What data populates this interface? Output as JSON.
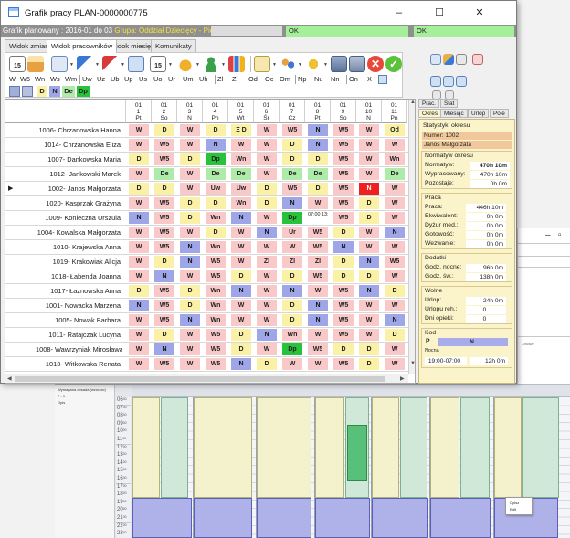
{
  "window": {
    "title": "Grafik pracy PLAN-0000000775",
    "minimize": "–",
    "maximize": "☐",
    "close": "✕"
  },
  "infobar": {
    "text": "Grafik planowany : 2016-01 do 03",
    "group": "Grupa: Oddział Dziecięcy - Pielęgniarki",
    "ok1": "OK",
    "ok2": "OK"
  },
  "tabs": [
    "Widok zmian",
    "Widok pracowników",
    "Widok miesięcy",
    "Komunikaty"
  ],
  "toolbar": {
    "codes": [
      "W",
      "W5",
      "Wn",
      "Ws",
      "Wm",
      "Uw",
      "Uz",
      "Ub",
      "Up",
      "Us",
      "Uo",
      "Ur",
      "Um",
      "Uh",
      "Zl",
      "Zi",
      "Od",
      "Oc",
      "Om",
      "Np",
      "Nu",
      "Nn",
      "On",
      "X"
    ],
    "shifts": [
      "D",
      "N",
      "De",
      "Dp"
    ],
    "calendar_day": "15"
  },
  "grid": {
    "days": [
      {
        "d": "1",
        "dow": "Pt"
      },
      {
        "d": "2",
        "dow": "So"
      },
      {
        "d": "3",
        "dow": "N"
      },
      {
        "d": "4",
        "dow": "Pn"
      },
      {
        "d": "5",
        "dow": "Wt"
      },
      {
        "d": "6",
        "dow": "Śr"
      },
      {
        "d": "7",
        "dow": "Cz"
      },
      {
        "d": "8",
        "dow": "Pt"
      },
      {
        "d": "9",
        "dow": "So"
      },
      {
        "d": "10",
        "dow": "N"
      },
      {
        "d": "11",
        "dow": "Pn"
      }
    ],
    "month": "01",
    "rows": [
      {
        "name": "1006- Chrzanowska Hanna",
        "cells": [
          "W",
          "D",
          "W",
          "D",
          "Ξ D",
          "W",
          "W5",
          "N",
          "W5",
          "W",
          "Od"
        ]
      },
      {
        "name": "1014- Chrzanowska Eliza",
        "cells": [
          "W",
          "W5",
          "W",
          "N",
          "W",
          "W",
          "D",
          "N",
          "W5",
          "W",
          "W"
        ]
      },
      {
        "name": "1007- Dankowska Maria",
        "cells": [
          "D",
          "W5",
          "D",
          "Dp",
          "Wn",
          "W",
          "D",
          "D",
          "W5",
          "W",
          "Wn"
        ]
      },
      {
        "name": "1012- Jankowski Marek",
        "cells": [
          "W",
          "De",
          "W",
          "De",
          "De",
          "W",
          "De",
          "De",
          "W5",
          "W",
          "De"
        ]
      },
      {
        "name": "1002- Janos Małgorzata",
        "cells": [
          "D",
          "D",
          "W",
          "Uw",
          "Uw",
          "D",
          "W5",
          "D",
          "W5",
          "N",
          "W"
        ]
      },
      {
        "name": "1020- Kasprzak Grażyna",
        "cells": [
          "W",
          "W5",
          "D",
          "D",
          "Wn",
          "D",
          "N",
          "W",
          "W5",
          "D",
          "W"
        ]
      },
      {
        "name": "1009- Konieczna Urszula",
        "cells": [
          "N",
          "W5",
          "D",
          "Wn",
          "N",
          "W",
          "Dp",
          "07:00 13:35",
          "W5",
          "D",
          "W"
        ]
      },
      {
        "name": "1004- Kowalska Małgorzata",
        "cells": [
          "W",
          "W5",
          "W",
          "D",
          "W",
          "N",
          "Ur",
          "W5",
          "D",
          "W",
          "N"
        ]
      },
      {
        "name": "1010- Krajewska Anna",
        "cells": [
          "W",
          "W5",
          "N",
          "Wn",
          "W",
          "W",
          "W",
          "W5",
          "N",
          "W",
          "W"
        ]
      },
      {
        "name": "1019- Krakowiak Alicja",
        "cells": [
          "W",
          "D",
          "N",
          "W5",
          "W",
          "Zl",
          "Zl",
          "Zl",
          "D",
          "N",
          "W5"
        ]
      },
      {
        "name": "1018- Łabenda Joanna",
        "cells": [
          "W",
          "N",
          "W",
          "W5",
          "D",
          "W",
          "D",
          "W5",
          "D",
          "D",
          "W"
        ]
      },
      {
        "name": "1017- Łaznowska Anna",
        "cells": [
          "D",
          "W5",
          "D",
          "Wn",
          "N",
          "W",
          "N",
          "W",
          "W5",
          "N",
          "D"
        ]
      },
      {
        "name": "1001- Nowacka Marzena",
        "cells": [
          "N",
          "W5",
          "D",
          "Wn",
          "W",
          "W",
          "D",
          "N",
          "W5",
          "W",
          "W"
        ]
      },
      {
        "name": "1005- Nowak Barbara",
        "cells": [
          "W",
          "W5",
          "N",
          "Wn",
          "W",
          "W",
          "D",
          "N",
          "W5",
          "W",
          "N"
        ]
      },
      {
        "name": "1011- Ratajczak Lucyna",
        "cells": [
          "W",
          "D",
          "W",
          "W5",
          "D",
          "N",
          "Wn",
          "W",
          "W5",
          "W",
          "D"
        ]
      },
      {
        "name": "1008- Wawrzyniak Mirosława",
        "cells": [
          "W",
          "N",
          "W",
          "W5",
          "D",
          "W",
          "Dp",
          "W5",
          "D",
          "D",
          "W"
        ]
      },
      {
        "name": "1013- Witkowska Renata",
        "cells": [
          "W",
          "W5",
          "W",
          "W5",
          "N",
          "D",
          "W",
          "W",
          "W5",
          "D",
          "W"
        ]
      }
    ]
  },
  "colors": {
    "W": "#f9c8c8",
    "D": "#fbf1a6",
    "N": "#9fa6e8",
    "De": "#aeeaa8",
    "Dp": "#27c43b",
    "Wn": "#f9c8c8",
    "Uw": "#f9c8c8",
    "Od": "#fbf1a6",
    "Ur": "#f9c8c8",
    "Zl": "#f9c8c8",
    "time": "#ffffff",
    "N_red": "#ee2020"
  },
  "right_panel": {
    "top_tabs": [
      "Prac.",
      "Stat"
    ],
    "sub_tabs": [
      "Okres",
      "Miesiąc",
      "Urlop",
      "Pole"
    ],
    "stats_title": "Statystyki okresu",
    "number_label": "Numer:",
    "number_value": "1002",
    "person": "Janos Małgorzata",
    "norm_title": "Normatyw okresu",
    "norm": [
      {
        "label": "Normatyw:",
        "value": "470h 10m"
      },
      {
        "label": "Wypracowany:",
        "value": "470h 10m"
      },
      {
        "label": "Pozostaje:",
        "value": "0h 0m"
      }
    ],
    "work_title": "Praca",
    "work": [
      {
        "label": "Praca:",
        "value": "446h 10m"
      },
      {
        "label": "Ekwiwalent:",
        "value": "0h 0m"
      },
      {
        "label": "Dyżur med.:",
        "value": "0h 0m"
      },
      {
        "label": "Gotowość:",
        "value": "0h 0m"
      },
      {
        "label": "Wezwanie:",
        "value": "0h 0m"
      }
    ],
    "extra_title": "Dodatki",
    "extra": [
      {
        "label": "Godz. nocne:",
        "value": "96h 0m"
      },
      {
        "label": "Godz. św.:",
        "value": "138h 0m"
      }
    ],
    "free_title": "Wolne",
    "free": [
      {
        "label": "Urlop:",
        "value": "24h 0m"
      },
      {
        "label": "Urlopu reh.:",
        "value": "0"
      },
      {
        "label": "Dni opieki:",
        "value": "0"
      }
    ],
    "code_title": "Kod",
    "code_letter": "P",
    "code_value": "N",
    "night_label": "Nocna",
    "night_time": "19:00-07:00",
    "night_hours": "12h 0m"
  },
  "background": {
    "side_title": "Wymagana obsada (wzorzec)",
    "side_sub": "7 - 9",
    "side_item": "Opis",
    "hours": [
      "06",
      "07",
      "08",
      "09",
      "10",
      "11",
      "12",
      "13",
      "14",
      "15",
      "16",
      "17",
      "18",
      "19",
      "20",
      "21",
      "22",
      "23"
    ],
    "ctx_items": [
      "Opisz",
      "Edit"
    ],
    "legend_text": "Losowe"
  }
}
